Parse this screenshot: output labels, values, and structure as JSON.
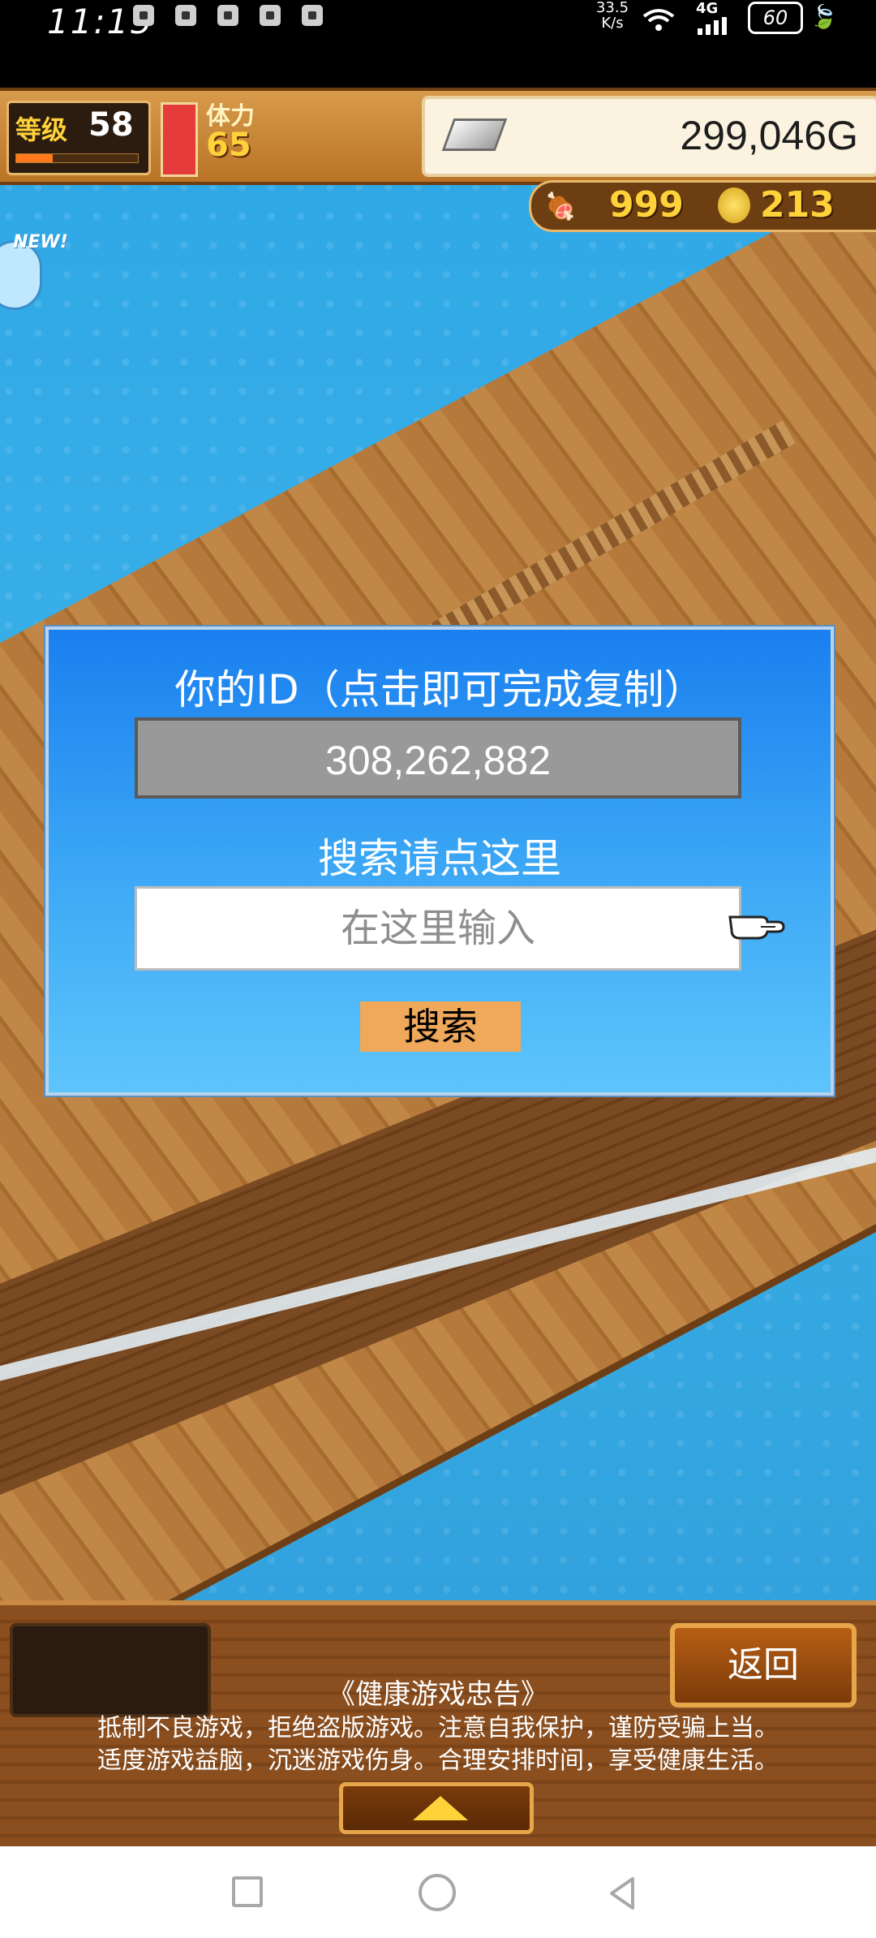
{
  "status_bar": {
    "time": "11:15",
    "net_speed_value": "33.5",
    "net_speed_unit": "K/s",
    "network": "4G",
    "battery": "60",
    "notification_icons": [
      "notif-icon-1",
      "notif-icon-2",
      "notif-icon-3",
      "notif-icon-4",
      "notif-icon-5"
    ]
  },
  "hud": {
    "level_label": "等级",
    "level": "58",
    "level_progress": 0.3,
    "stamina_label": "体力",
    "stamina": "65",
    "gold": "299,046G",
    "meat": "999",
    "medals": "213",
    "new_badge": "NEW!"
  },
  "dialog": {
    "id_title": "你的ID（点击即可完成复制）",
    "id_value": "308,262,882",
    "search_hint": "搜索请点这里",
    "search_placeholder": "在这里输入",
    "search_button": "搜索"
  },
  "bottom": {
    "back_button": "返回",
    "notice_title": "《健康游戏忠告》",
    "notice_line1": "抵制不良游戏，拒绝盗版游戏。注意自我保护，谨防受骗上当。",
    "notice_line2": "适度游戏益脑，沉迷游戏伤身。合理安排时间，享受健康生活。"
  },
  "colors": {
    "dialog_top": "#1a7fef",
    "dialog_bottom": "#5ec5fb",
    "search_button": "#f0a85a",
    "hud_gold": "#ffd23a"
  }
}
